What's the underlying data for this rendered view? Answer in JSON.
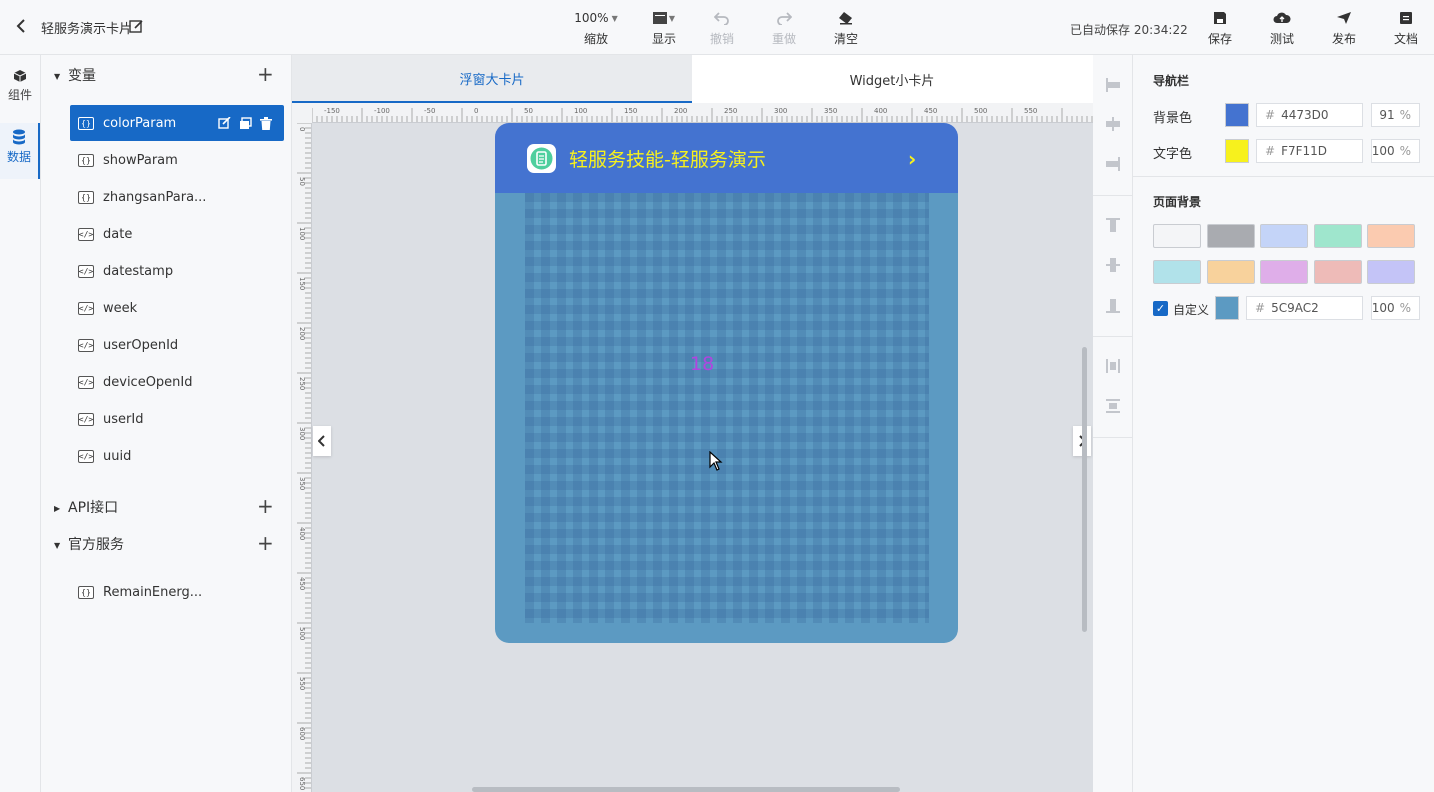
{
  "header": {
    "title": "轻服务演示卡片",
    "zoom_value": "100%",
    "zoom_label": "缩放",
    "display_label": "显示",
    "undo_label": "撤销",
    "redo_label": "重做",
    "clear_label": "清空",
    "autosave_text": "已自动保存 20:34:22",
    "save_label": "保存",
    "test_label": "测试",
    "publish_label": "发布",
    "docs_label": "文档"
  },
  "rail": {
    "components_label": "组件",
    "data_label": "数据"
  },
  "panel": {
    "variables_label": "变量",
    "variables": [
      {
        "name": "colorParam",
        "type": "object"
      },
      {
        "name": "showParam",
        "type": "object"
      },
      {
        "name": "zhangsanPara...",
        "type": "object"
      },
      {
        "name": "date",
        "type": "system"
      },
      {
        "name": "datestamp",
        "type": "system"
      },
      {
        "name": "week",
        "type": "system"
      },
      {
        "name": "userOpenId",
        "type": "system"
      },
      {
        "name": "deviceOpenId",
        "type": "system"
      },
      {
        "name": "userId",
        "type": "system"
      },
      {
        "name": "uuid",
        "type": "system"
      }
    ],
    "api_label": "API接口",
    "official_label": "官方服务",
    "official_items": [
      {
        "name": "RemainEnerg...",
        "type": "object"
      }
    ]
  },
  "canvas": {
    "tab_large": "浮窗大卡片",
    "tab_widget": "Widget小卡片",
    "ruler_h": [
      "-150",
      "-100",
      "-50",
      "0",
      "50",
      "100",
      "150",
      "200",
      "250",
      "300",
      "350",
      "400",
      "450",
      "500",
      "550"
    ],
    "ruler_v": [
      "0",
      "50",
      "100",
      "150",
      "200",
      "250",
      "300",
      "350",
      "400",
      "450",
      "500",
      "550",
      "600",
      "650"
    ],
    "card_title": "轻服务技能-轻服务演示",
    "card_value": "18"
  },
  "right": {
    "navbar_heading": "导航栏",
    "bgcolor_label": "背景色",
    "bgcolor_hex": "4473D0",
    "bgcolor_pct": "91",
    "textcolor_label": "文字色",
    "textcolor_hex": "F7F11D",
    "textcolor_pct": "100",
    "page_bg_heading": "页面背景",
    "custom_label": "自定义",
    "custom_hex": "5C9AC2",
    "custom_pct": "100",
    "percent_sign": "%"
  },
  "colors": {
    "accent": "#1769c6",
    "nav_bg": "#4473D0",
    "nav_text": "#F7F11D",
    "page_bg": "#5C9AC2",
    "presets": [
      "#f4f5f7",
      "#a9abb0",
      "#c4d4f8",
      "#9fe6cd",
      "#fbcbb0",
      "#b1e2ea",
      "#f8d29c",
      "#dfaee9",
      "#eebbb8",
      "#c4c4f7"
    ]
  }
}
